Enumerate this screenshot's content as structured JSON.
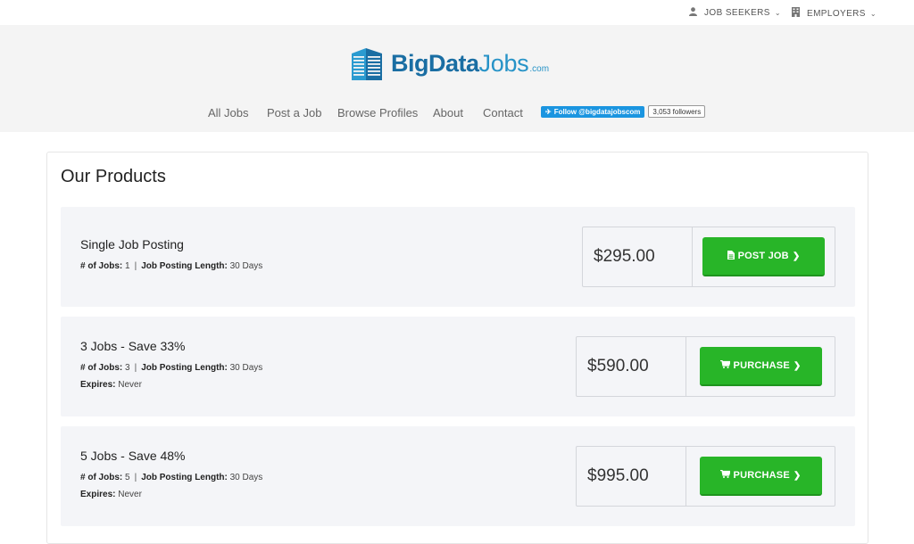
{
  "topbar": {
    "job_seekers": "JOB SEEKERS",
    "employers": "EMPLOYERS",
    "seekers_icon": "user-icon",
    "employers_icon": "building-icon"
  },
  "brand": {
    "big": "Big",
    "data": "Data",
    "jobs": "Jobs",
    "com": ".com",
    "color_dark": "#1a6ea3",
    "color_light": "#2793c7"
  },
  "nav": {
    "items": [
      "All Jobs",
      "Post a Job",
      "Browse Profiles",
      "About",
      "Contact"
    ]
  },
  "twitter": {
    "follow": "Follow @bigdatajobscom",
    "followers": "3,053 followers"
  },
  "main": {
    "title": "Our Products",
    "products": [
      {
        "name": "Single Job Posting",
        "jobs_label": "# of Jobs:",
        "jobs": "1",
        "length_label": "Job Posting Length:",
        "length": "30 Days",
        "price": "$295.00",
        "button": "POST JOB",
        "button_icon": "file-icon"
      },
      {
        "name": "3 Jobs - Save 33%",
        "jobs_label": "# of Jobs:",
        "jobs": "3",
        "length_label": "Job Posting Length:",
        "length": "30 Days",
        "expires_label": "Expires:",
        "expires": "Never",
        "price": "$590.00",
        "button": "PURCHASE",
        "button_icon": "cart-icon"
      },
      {
        "name": "5 Jobs - Save 48%",
        "jobs_label": "# of Jobs:",
        "jobs": "5",
        "length_label": "Job Posting Length:",
        "length": "30 Days",
        "expires_label": "Expires:",
        "expires": "Never",
        "price": "$995.00",
        "button": "PURCHASE",
        "button_icon": "cart-icon"
      }
    ],
    "button_color": "#28b528"
  }
}
